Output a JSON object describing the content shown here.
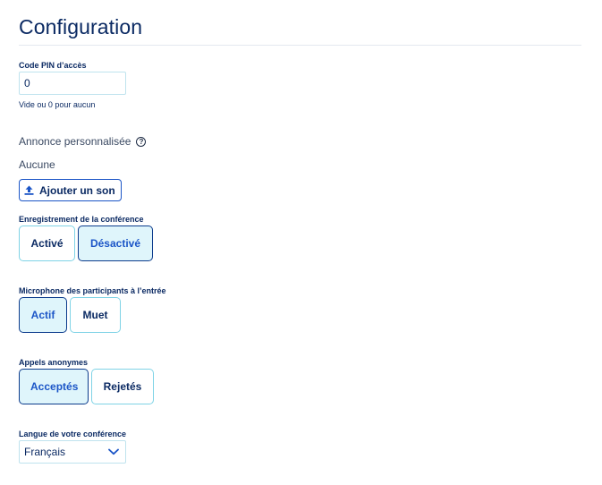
{
  "page": {
    "title": "Configuration"
  },
  "pin": {
    "label": "Code PIN d’accès",
    "value": "0",
    "help": "Vide ou 0 pour aucun"
  },
  "announcement": {
    "heading": "Annonce personnalisée",
    "help_icon": "question-circle-icon",
    "current": "Aucune",
    "upload_label": "Ajouter un son",
    "upload_icon": "upload-icon"
  },
  "recording": {
    "label": "Enregistrement de la conférence",
    "options": [
      "Activé",
      "Désactivé"
    ],
    "selected": "Désactivé"
  },
  "microphone": {
    "label": "Microphone des participants à l’entrée",
    "options": [
      "Actif",
      "Muet"
    ],
    "selected": "Actif"
  },
  "anonymous": {
    "label": "Appels anonymes",
    "options": [
      "Acceptés",
      "Rejetés"
    ],
    "selected": "Acceptés"
  },
  "language": {
    "label": "Langue de votre conférence",
    "selected": "Français",
    "dropdown_icon": "chevron-down-icon"
  },
  "colors": {
    "text": "#0b2a63",
    "accent": "#1b55c7",
    "selected_bg": "#dff5fb",
    "border_light": "#7fd3e6"
  }
}
